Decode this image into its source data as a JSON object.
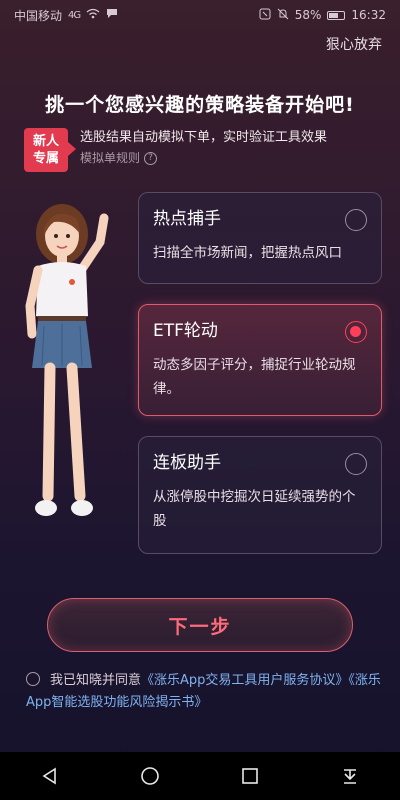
{
  "status_bar": {
    "carrier": "中国移动",
    "signal": "4G",
    "battery": "58%",
    "time": "16:32"
  },
  "header": {
    "abandon_label": "狠心放弃"
  },
  "headline": "挑一个您感兴趣的策略装备开始吧!",
  "notice": {
    "badge_line1": "新人",
    "badge_line2": "专属",
    "main_text": "选股结果自动模拟下单，实时验证工具效果",
    "rule_text": "模拟单规则"
  },
  "strategies": [
    {
      "title": "热点捕手",
      "desc": "扫描全市场新闻，把握热点风口",
      "selected": false
    },
    {
      "title": "ETF轮动",
      "desc": "动态多因子评分，捕捉行业轮动规律。",
      "selected": true
    },
    {
      "title": "连板助手",
      "desc": "从涨停股中挖掘次日延续强势的个股",
      "selected": false
    }
  ],
  "next_button_label": "下一步",
  "agreement": {
    "prefix": "我已知晓并同意",
    "link1": "《涨乐App交易工具用户服务协议》",
    "link2": "《涨乐App智能选股功能风险揭示书》"
  },
  "colors": {
    "accent": "#ff3f5a",
    "badge": "#e23a4f",
    "link": "#7fb2f0"
  }
}
